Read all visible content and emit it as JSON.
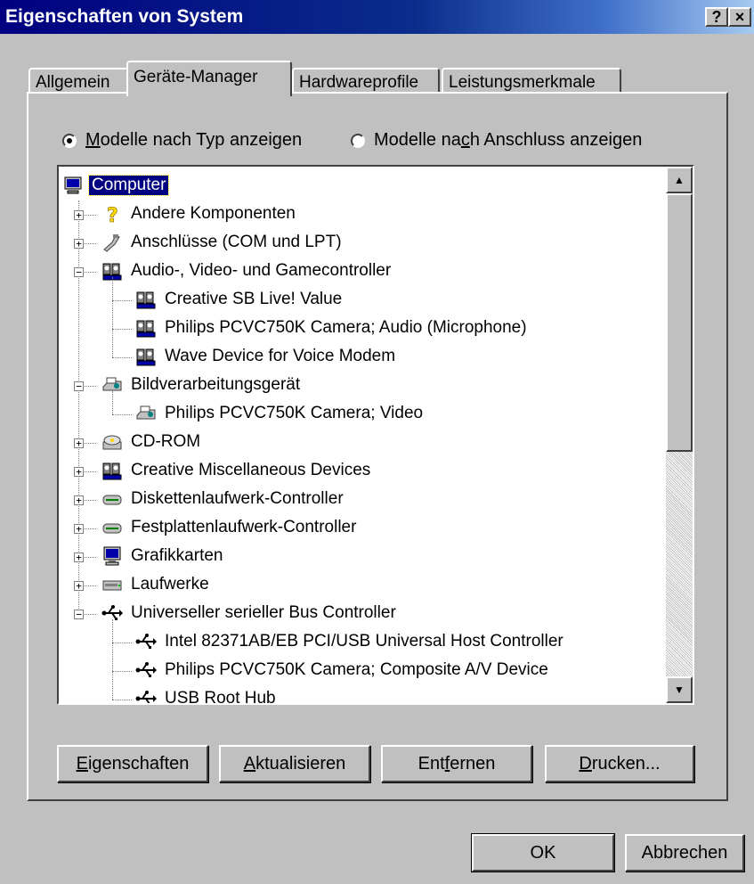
{
  "window": {
    "title": "Eigenschaften von System",
    "help_glyph": "?",
    "close_glyph": "×"
  },
  "tabs": [
    {
      "label": "Allgemein",
      "active": false
    },
    {
      "label": "Geräte-Manager",
      "active": true
    },
    {
      "label": "Hardwareprofile",
      "active": false
    },
    {
      "label": "Leistungsmerkmale",
      "active": false
    }
  ],
  "view_options": {
    "by_type": {
      "pre": "",
      "mn": "M",
      "post": "odelle nach Typ anzeigen",
      "selected": true
    },
    "by_connection": {
      "pre": "Modelle na",
      "mn": "c",
      "post": "h Anschluss anzeigen",
      "selected": false
    }
  },
  "tree": [
    {
      "label": "Computer",
      "icon": "computer-icon",
      "level": 0,
      "selected": true
    },
    {
      "label": "Andere Komponenten",
      "icon": "question-icon",
      "level": 1,
      "expander": "+"
    },
    {
      "label": "Anschlüsse (COM und LPT)",
      "icon": "port-icon",
      "level": 1,
      "expander": "+"
    },
    {
      "label": "Audio-, Video- und Gamecontroller",
      "icon": "multimedia-icon",
      "level": 1,
      "expander": "-"
    },
    {
      "label": "Creative SB Live! Value",
      "icon": "multimedia-icon",
      "level": 2
    },
    {
      "label": "Philips PCVC750K Camera; Audio (Microphone)",
      "icon": "multimedia-icon",
      "level": 2
    },
    {
      "label": "Wave Device for Voice Modem",
      "icon": "multimedia-icon",
      "level": 2
    },
    {
      "label": "Bildverarbeitungsgerät",
      "icon": "imaging-icon",
      "level": 1,
      "expander": "-"
    },
    {
      "label": "Philips PCVC750K Camera; Video",
      "icon": "imaging-icon",
      "level": 2
    },
    {
      "label": "CD-ROM",
      "icon": "cdrom-icon",
      "level": 1,
      "expander": "+"
    },
    {
      "label": "Creative Miscellaneous Devices",
      "icon": "multimedia-icon",
      "level": 1,
      "expander": "+"
    },
    {
      "label": "Diskettenlaufwerk-Controller",
      "icon": "controller-icon",
      "level": 1,
      "expander": "+"
    },
    {
      "label": "Festplattenlaufwerk-Controller",
      "icon": "controller-icon",
      "level": 1,
      "expander": "+"
    },
    {
      "label": "Grafikkarten",
      "icon": "monitor-icon",
      "level": 1,
      "expander": "+"
    },
    {
      "label": "Laufwerke",
      "icon": "drive-icon",
      "level": 1,
      "expander": "+"
    },
    {
      "label": "Universeller serieller Bus Controller",
      "icon": "usb-icon",
      "level": 1,
      "expander": "-"
    },
    {
      "label": "Intel 82371AB/EB PCI/USB Universal Host Controller",
      "icon": "usb-icon",
      "level": 2
    },
    {
      "label": "Philips PCVC750K Camera; Composite A/V Device",
      "icon": "usb-icon",
      "level": 2
    },
    {
      "label": "USB Root Hub",
      "icon": "usb-icon",
      "level": 2
    }
  ],
  "panel_buttons": [
    {
      "pre": "",
      "mn": "E",
      "post": "igenschaften"
    },
    {
      "pre": "",
      "mn": "A",
      "post": "ktualisieren"
    },
    {
      "pre": "Ent",
      "mn": "f",
      "post": "ernen"
    },
    {
      "pre": "",
      "mn": "D",
      "post": "rucken..."
    }
  ],
  "dialog_buttons": {
    "ok": "OK",
    "cancel": "Abbrechen"
  },
  "colors": {
    "title_start": "#000080",
    "title_end": "#a6caf0",
    "face": "#c0c0c0",
    "selection": "#000080"
  }
}
